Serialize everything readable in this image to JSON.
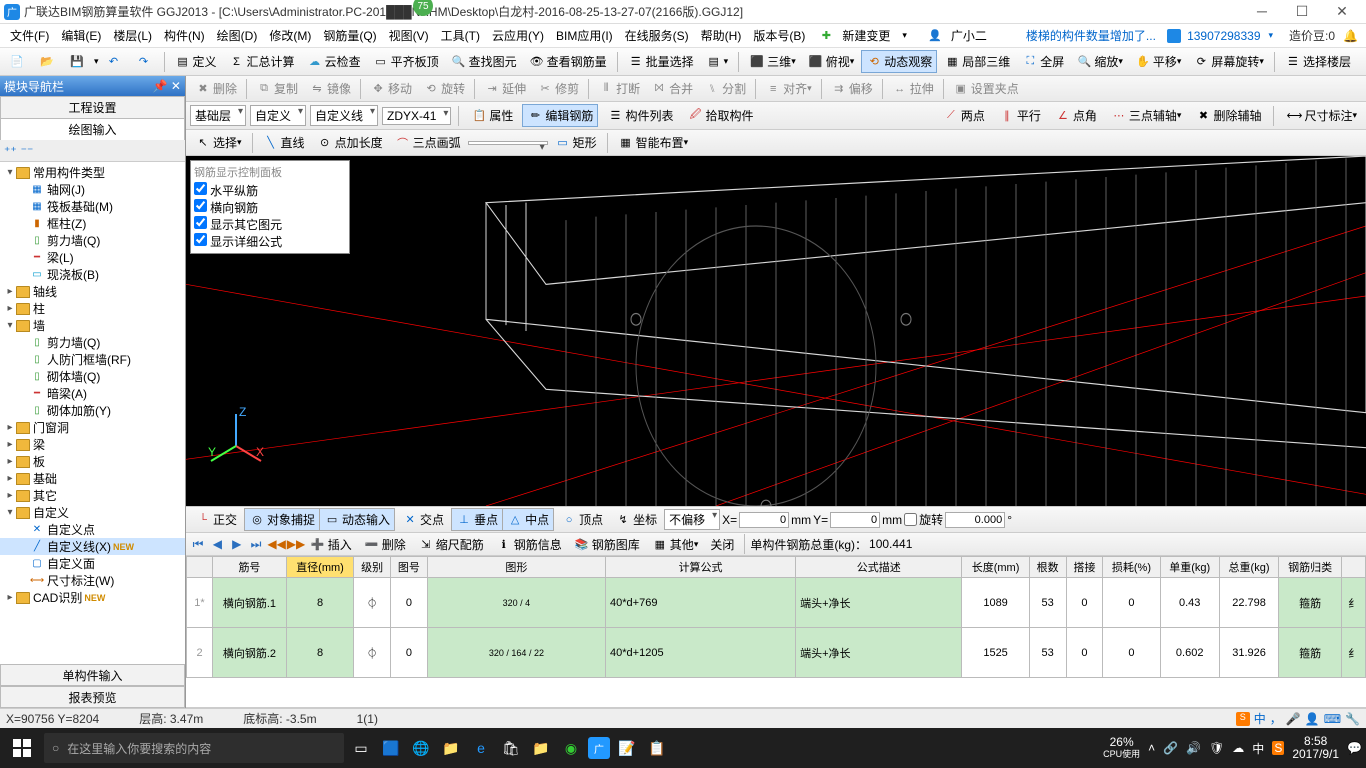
{
  "title": "广联达BIM钢筋算量软件 GGJ2013 - [C:\\Users\\Administrator.PC-201███NRHM\\Desktop\\白龙村-2016-08-25-13-27-07(2166版).GGJ12]",
  "badge": "75",
  "menus": [
    "文件(F)",
    "编辑(E)",
    "楼层(L)",
    "构件(N)",
    "绘图(D)",
    "修改(M)",
    "钢筋量(Q)",
    "视图(V)",
    "工具(T)",
    "云应用(Y)",
    "BIM应用(I)",
    "在线服务(S)",
    "帮助(H)",
    "版本号(B)"
  ],
  "menu_new": "新建变更",
  "menu_user": "广小二",
  "menu_notice": "楼梯的构件数量增加了...",
  "acct": "13907298339",
  "credit_label": "造价豆:0",
  "tb1": {
    "define": "定义",
    "sumcalc": "汇总计算",
    "cloudcheck": "云检查",
    "flattop": "平齐板顶",
    "findgraph": "查找图元",
    "viewrebar": "查看钢筋量",
    "batchsel": "批量选择",
    "threed": "三维",
    "top": "俯视",
    "dynview": "动态观察",
    "partial3d": "局部三维",
    "fullscr": "全屏",
    "zoom": "缩放",
    "pan": "平移",
    "scrrot": "屏幕旋转",
    "selfloor": "选择楼层"
  },
  "tb2": {
    "del": "删除",
    "copy": "复制",
    "mirror": "镜像",
    "move": "移动",
    "rotate": "旋转",
    "extend": "延伸",
    "trim": "修剪",
    "break": "打断",
    "merge": "合并",
    "split": "分割",
    "align": "对齐",
    "offset": "偏移",
    "stretch": "拉伸",
    "setgrip": "设置夹点"
  },
  "sel": {
    "floor": "基础层",
    "cat": "自定义",
    "type": "自定义线",
    "code": "ZDYX-41",
    "attr": "属性",
    "editrebar": "编辑钢筋",
    "list": "构件列表",
    "pick": "拾取构件",
    "twopoint": "两点",
    "parallel": "平行",
    "pointangle": "点角",
    "threeaux": "三点辅轴",
    "delaux": "删除辅轴",
    "dimmark": "尺寸标注"
  },
  "drawtb": {
    "select": "选择",
    "line": "直线",
    "addlen": "点加长度",
    "threearc": "三点画弧",
    "rect": "矩形",
    "smartlayout": "智能布置"
  },
  "sidebar": {
    "header": "模块导航栏",
    "tab1": "工程设置",
    "tab2": "绘图输入",
    "bottom1": "单构件输入",
    "bottom2": "报表预览"
  },
  "tree": [
    {
      "l": 0,
      "t": "▾",
      "ic": "folder",
      "txt": "常用构件类型"
    },
    {
      "l": 1,
      "ic": "grid",
      "txt": "轴网(J)"
    },
    {
      "l": 1,
      "ic": "grid",
      "txt": "筏板基础(M)"
    },
    {
      "l": 1,
      "ic": "col",
      "txt": "框柱(Z)"
    },
    {
      "l": 1,
      "ic": "wall",
      "txt": "剪力墙(Q)"
    },
    {
      "l": 1,
      "ic": "beam",
      "txt": "梁(L)"
    },
    {
      "l": 1,
      "ic": "slab",
      "txt": "现浇板(B)"
    },
    {
      "l": 0,
      "t": "▸",
      "ic": "folder",
      "txt": "轴线"
    },
    {
      "l": 0,
      "t": "▸",
      "ic": "folder",
      "txt": "柱"
    },
    {
      "l": 0,
      "t": "▾",
      "ic": "folder",
      "txt": "墙"
    },
    {
      "l": 1,
      "ic": "wall",
      "txt": "剪力墙(Q)"
    },
    {
      "l": 1,
      "ic": "wall",
      "txt": "人防门框墙(RF)"
    },
    {
      "l": 1,
      "ic": "wall",
      "txt": "砌体墙(Q)"
    },
    {
      "l": 1,
      "ic": "beam",
      "txt": "暗梁(A)"
    },
    {
      "l": 1,
      "ic": "wall",
      "txt": "砌体加筋(Y)"
    },
    {
      "l": 0,
      "t": "▸",
      "ic": "folder",
      "txt": "门窗洞"
    },
    {
      "l": 0,
      "t": "▸",
      "ic": "folder",
      "txt": "梁"
    },
    {
      "l": 0,
      "t": "▸",
      "ic": "folder",
      "txt": "板"
    },
    {
      "l": 0,
      "t": "▸",
      "ic": "folder",
      "txt": "基础"
    },
    {
      "l": 0,
      "t": "▸",
      "ic": "folder",
      "txt": "其它"
    },
    {
      "l": 0,
      "t": "▾",
      "ic": "folder",
      "txt": "自定义"
    },
    {
      "l": 1,
      "ic": "pt",
      "txt": "自定义点"
    },
    {
      "l": 1,
      "ic": "ln",
      "txt": "自定义线(X)",
      "new": true,
      "sel": true
    },
    {
      "l": 1,
      "ic": "fc",
      "txt": "自定义面"
    },
    {
      "l": 1,
      "ic": "dm",
      "txt": "尺寸标注(W)"
    },
    {
      "l": 0,
      "t": "▸",
      "ic": "folder",
      "txt": "CAD识别",
      "new": true
    }
  ],
  "rebar_panel": {
    "title": "钢筋显示控制面板",
    "items": [
      "水平纵筋",
      "横向钢筋",
      "显示其它图元",
      "显示详细公式"
    ]
  },
  "snap": {
    "ortho": "正交",
    "objsnap": "对象捕捉",
    "dyninput": "动态输入",
    "intersect": "交点",
    "perp": "垂点",
    "mid": "中点",
    "vertex": "顶点",
    "seat": "坐标",
    "nooffset": "不偏移",
    "x": "X=",
    "y": "Y=",
    "mm": "mm",
    "rotate": "旋转",
    "xval": "0",
    "yval": "0",
    "rotval": "0.000"
  },
  "tabletb": {
    "insert": "插入",
    "delete": "删除",
    "proportion": "缩尺配筋",
    "rebarinfo": "钢筋信息",
    "rebarlib": "钢筋图库",
    "other": "其他",
    "close": "关闭",
    "totalLabel": "单构件钢筋总重(kg)：",
    "totalVal": "100.441"
  },
  "grid": {
    "headers": [
      "",
      "筋号",
      "直径(mm)",
      "级别",
      "图号",
      "图形",
      "计算公式",
      "公式描述",
      "长度(mm)",
      "根数",
      "搭接",
      "损耗(%)",
      "单重(kg)",
      "总重(kg)",
      "钢筋归类",
      ""
    ],
    "rows": [
      {
        "n": "1*",
        "a": "横向钢筋.1",
        "b": "8",
        "c": "⏀",
        "d": "0",
        "shape": "320 / 4",
        "f": "40*d+769",
        "g": "端头+净长",
        "h": "1089",
        "i": "53",
        "j": "0",
        "k": "0",
        "l": "0.43",
        "m": "22.798",
        "o": "箍筋",
        "p": "纟"
      },
      {
        "n": "2",
        "a": "横向钢筋.2",
        "b": "8",
        "c": "⏀",
        "d": "0",
        "shape": "320 / 164 / 22",
        "f": "40*d+1205",
        "g": "端头+净长",
        "h": "1525",
        "i": "53",
        "j": "0",
        "k": "0",
        "l": "0.602",
        "m": "31.926",
        "o": "箍筋",
        "p": "纟"
      }
    ]
  },
  "status": {
    "coord": "X=90756 Y=8204",
    "floorH": "层高: 3.47m",
    "baseElev": "底标高: -3.5m",
    "page": "1(1)"
  },
  "taskbar": {
    "search": "在这里输入你要搜索的内容",
    "cpu_pct": "26%",
    "cpu_lbl": "CPU使用",
    "time": "8:58",
    "date": "2017/9/1",
    "ime": "中"
  }
}
